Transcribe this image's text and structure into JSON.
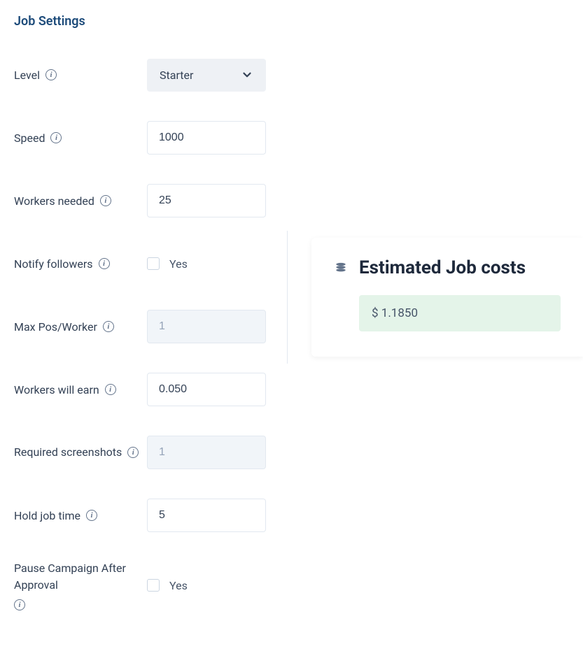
{
  "section_title": "Job Settings",
  "level": {
    "label": "Level",
    "selected": "Starter"
  },
  "speed": {
    "label": "Speed",
    "value": "1000"
  },
  "workers_needed": {
    "label": "Workers needed",
    "value": "25"
  },
  "notify_followers": {
    "label": "Notify followers",
    "option_label": "Yes"
  },
  "max_pos": {
    "label": "Max Pos/Worker",
    "value": "1"
  },
  "workers_earn": {
    "label": "Workers will earn",
    "value": "0.050"
  },
  "required_screenshots": {
    "label": "Required screenshots",
    "value": "1"
  },
  "hold_job_time": {
    "label": "Hold job time",
    "value": "5"
  },
  "pause_campaign": {
    "label": "Pause Campaign After Approval",
    "option_label": "Yes"
  },
  "cost_panel": {
    "title": "Estimated Job costs",
    "value": "$ 1.1850"
  }
}
